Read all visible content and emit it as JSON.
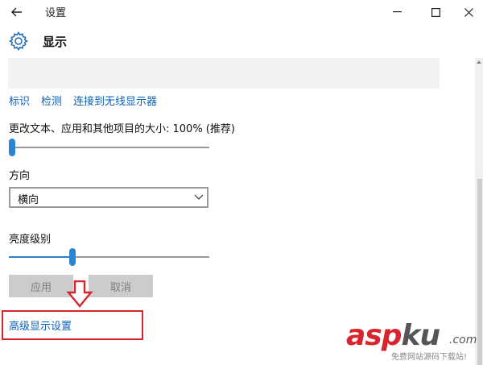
{
  "window": {
    "title": "设置",
    "header_title": "显示"
  },
  "links": [
    "标识",
    "检测",
    "连接到无线显示器"
  ],
  "scale": {
    "label": "更改文本、应用和其他项目的大小: 100% (推荐)",
    "value_fraction": 0.0
  },
  "orientation": {
    "label": "方向",
    "selected": "横向"
  },
  "brightness": {
    "label": "亮度级别",
    "value_fraction": 0.31
  },
  "buttons": {
    "apply": "应用",
    "cancel": "取消"
  },
  "advanced_link": "高级显示设置",
  "watermark": {
    "asp": "asp",
    "ku": "ku",
    "com": ".com",
    "sub": "免费网站源码下载站!"
  },
  "colors": {
    "link": "#0a62b8",
    "accent": "#2a84cf",
    "highlight": "#d8242c"
  },
  "icons": {
    "back": "back-arrow-icon",
    "settings": "gear-icon",
    "minimize": "minimize-icon",
    "maximize": "maximize-icon",
    "close": "close-icon",
    "dropdown": "chevron-down-icon",
    "annotation": "down-arrow-icon"
  }
}
